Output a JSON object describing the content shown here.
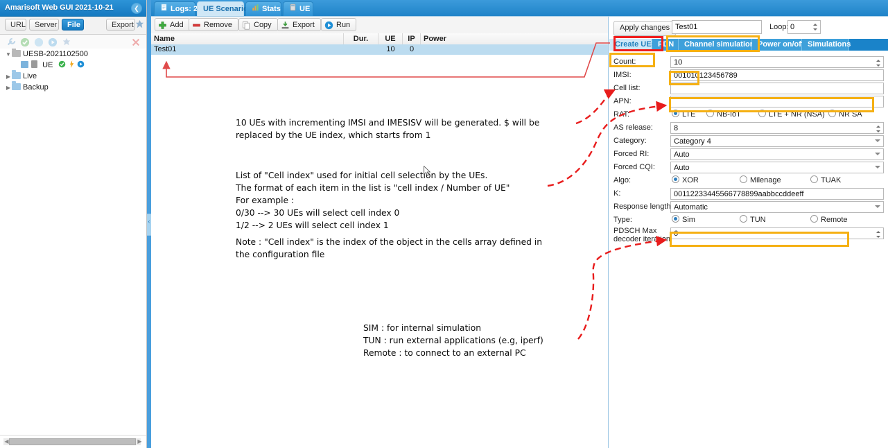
{
  "app": {
    "title": "Amarisoft Web GUI 2021-10-21",
    "collapse_icon": "chevron-left-icon"
  },
  "left_panel": {
    "source_buttons": [
      {
        "label": "URL",
        "active": false
      },
      {
        "label": "Server",
        "active": false
      },
      {
        "label": "File",
        "active": true
      }
    ],
    "export_label": "Export",
    "tool_icons": [
      "wrench-icon",
      "check-circle-icon",
      "refresh-icon",
      "play-circle-icon",
      "pin-icon",
      "close-x-icon"
    ],
    "tree": [
      {
        "label": "UESB-2021102500",
        "depth": 0,
        "arrow": "▼",
        "folder": "grey"
      },
      {
        "label": "UE",
        "depth": 1,
        "arrow": "",
        "folder": "none",
        "badges": [
          "grid-icon",
          "calc-icon",
          "check-icon",
          "bolt-icon",
          "play-icon"
        ]
      },
      {
        "label": "Live",
        "depth": 0,
        "arrow": "▶",
        "folder": "blue"
      },
      {
        "label": "Backup",
        "depth": 0,
        "arrow": "▶",
        "folder": "blue"
      }
    ]
  },
  "tabs": [
    {
      "label": "Logs: 2",
      "icon": "document-icon",
      "selected": false
    },
    {
      "label": "UE Scenario",
      "icon": "",
      "selected": true
    },
    {
      "label": "Stats",
      "icon": "bar-chart-icon",
      "selected": false
    },
    {
      "label": "UE",
      "icon": "calc-icon",
      "selected": false
    }
  ],
  "center": {
    "toolbar": [
      {
        "label": "Add",
        "icon": "plus-icon"
      },
      {
        "label": "Remove",
        "icon": "minus-icon"
      },
      {
        "label": "Copy",
        "icon": "copy-icon"
      },
      {
        "label": "Export",
        "icon": "export-icon"
      },
      {
        "label": "Run",
        "icon": "play-icon"
      }
    ],
    "columns": [
      "Name",
      "Dur.",
      "UE",
      "IP",
      "Power"
    ],
    "rows": [
      {
        "name": "Test01",
        "dur": "",
        "ue": "10",
        "ip": "0",
        "power": ""
      }
    ]
  },
  "form": {
    "apply_label": "Apply changes",
    "scenario_name": "Test01",
    "loop_label": "Loop:",
    "loop_value": "0",
    "subtabs": [
      {
        "label": "Create UEs",
        "selected": true
      },
      {
        "label": "PDN",
        "selected": false
      },
      {
        "label": "Channel simulation",
        "selected": false
      },
      {
        "label": "Power on/off",
        "selected": false
      },
      {
        "label": "Simulations",
        "selected": false
      }
    ],
    "fields": [
      {
        "name": "count",
        "label": "Count:",
        "type": "spinner",
        "value": "10"
      },
      {
        "name": "imsi",
        "label": "IMSI:",
        "type": "text",
        "value": "001010123456789"
      },
      {
        "name": "cell-list",
        "label": "Cell list:",
        "type": "text",
        "value": ""
      },
      {
        "name": "apn",
        "label": "APN:",
        "type": "text",
        "value": ""
      },
      {
        "name": "rat",
        "label": "RAT:",
        "type": "radio",
        "options": [
          "LTE",
          "NB-IoT",
          "LTE + NR (NSA)",
          "NR SA"
        ],
        "selected": 0
      },
      {
        "name": "as-release",
        "label": "AS release:",
        "type": "spinner",
        "value": "8"
      },
      {
        "name": "category",
        "label": "Category:",
        "type": "select",
        "value": "Category 4"
      },
      {
        "name": "forced-ri",
        "label": "Forced RI:",
        "type": "select",
        "value": "Auto"
      },
      {
        "name": "forced-cqi",
        "label": "Forced CQI:",
        "type": "select",
        "value": "Auto"
      },
      {
        "name": "algo",
        "label": "Algo:",
        "type": "radio",
        "options": [
          "XOR",
          "Milenage",
          "TUAK"
        ],
        "selected": 0
      },
      {
        "name": "k",
        "label": "K:",
        "type": "text",
        "value": "00112233445566778899aabbccddeeff"
      },
      {
        "name": "response-length",
        "label": "Response length:",
        "type": "select",
        "value": "Automatic"
      },
      {
        "name": "type",
        "label": "Type:",
        "type": "radio",
        "options": [
          "Sim",
          "TUN",
          "Remote"
        ],
        "selected": 0
      },
      {
        "name": "pdsch-max-decoder-iteration",
        "label": "PDSCH Max\ndecoder iteration:",
        "type": "spinner",
        "value": "6"
      }
    ]
  },
  "annotations": [
    {
      "name": "imsi-note",
      "text": "10 UEs with incrementing IMSI and IMESISV will be generated. $ will be\nreplaced by the UE index, which starts from 1"
    },
    {
      "name": "cell-list-note",
      "text": "List of \"Cell index\" used for initial cell selection by the UEs.\nThe format of each item in the list is \"cell index / Number of UE\"\nFor example :\n0/30 --> 30 UEs will select cell index 0\n1/2 --> 2 UEs will select cell index 1"
    },
    {
      "name": "cell-index-note",
      "text": "Note : \"Cell index\" is the index of the object in the cells array defined in\nthe configuration file"
    },
    {
      "name": "type-note",
      "text": "SIM : for internal simulation\nTUN : run external applications (e.g, iperf)\nRemote : to connect to an external PC"
    }
  ],
  "colors": {
    "highlight_orange": "#f5b013",
    "highlight_red": "#ef1d1d",
    "arrow_red": "#e81c1c",
    "header_blue": "#1a83c9",
    "selected_row": "#bcdcf0"
  }
}
